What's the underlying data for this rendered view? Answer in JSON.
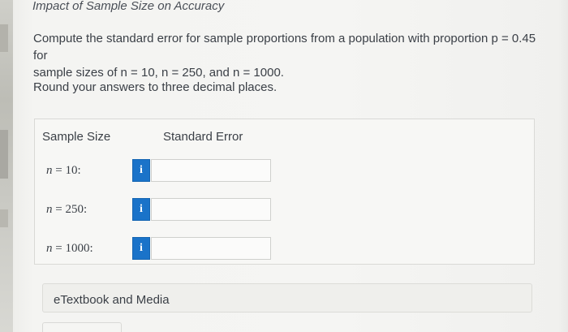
{
  "header": {
    "title": "Impact of Sample Size on Accuracy"
  },
  "question": {
    "line1": "Compute the standard error for sample proportions from a population with proportion p = 0.45 for",
    "line2": "sample sizes of n = 10, n = 250, and n = 1000.",
    "rounding": "Round your answers to three decimal places."
  },
  "table": {
    "col_sample_size": "Sample Size",
    "col_standard_error": "Standard Error",
    "rows": [
      {
        "var": "n",
        "label": " = 10:",
        "info": "i",
        "value": ""
      },
      {
        "var": "n",
        "label": " = 250:",
        "info": "i",
        "value": ""
      },
      {
        "var": "n",
        "label": " = 1000:",
        "info": "i",
        "value": ""
      }
    ]
  },
  "resources": {
    "etextbook_label": "eTextbook and Media"
  },
  "colors": {
    "info_button": "#1a73c9",
    "text": "#3a3f46"
  },
  "icons": {
    "info": "info-icon"
  }
}
